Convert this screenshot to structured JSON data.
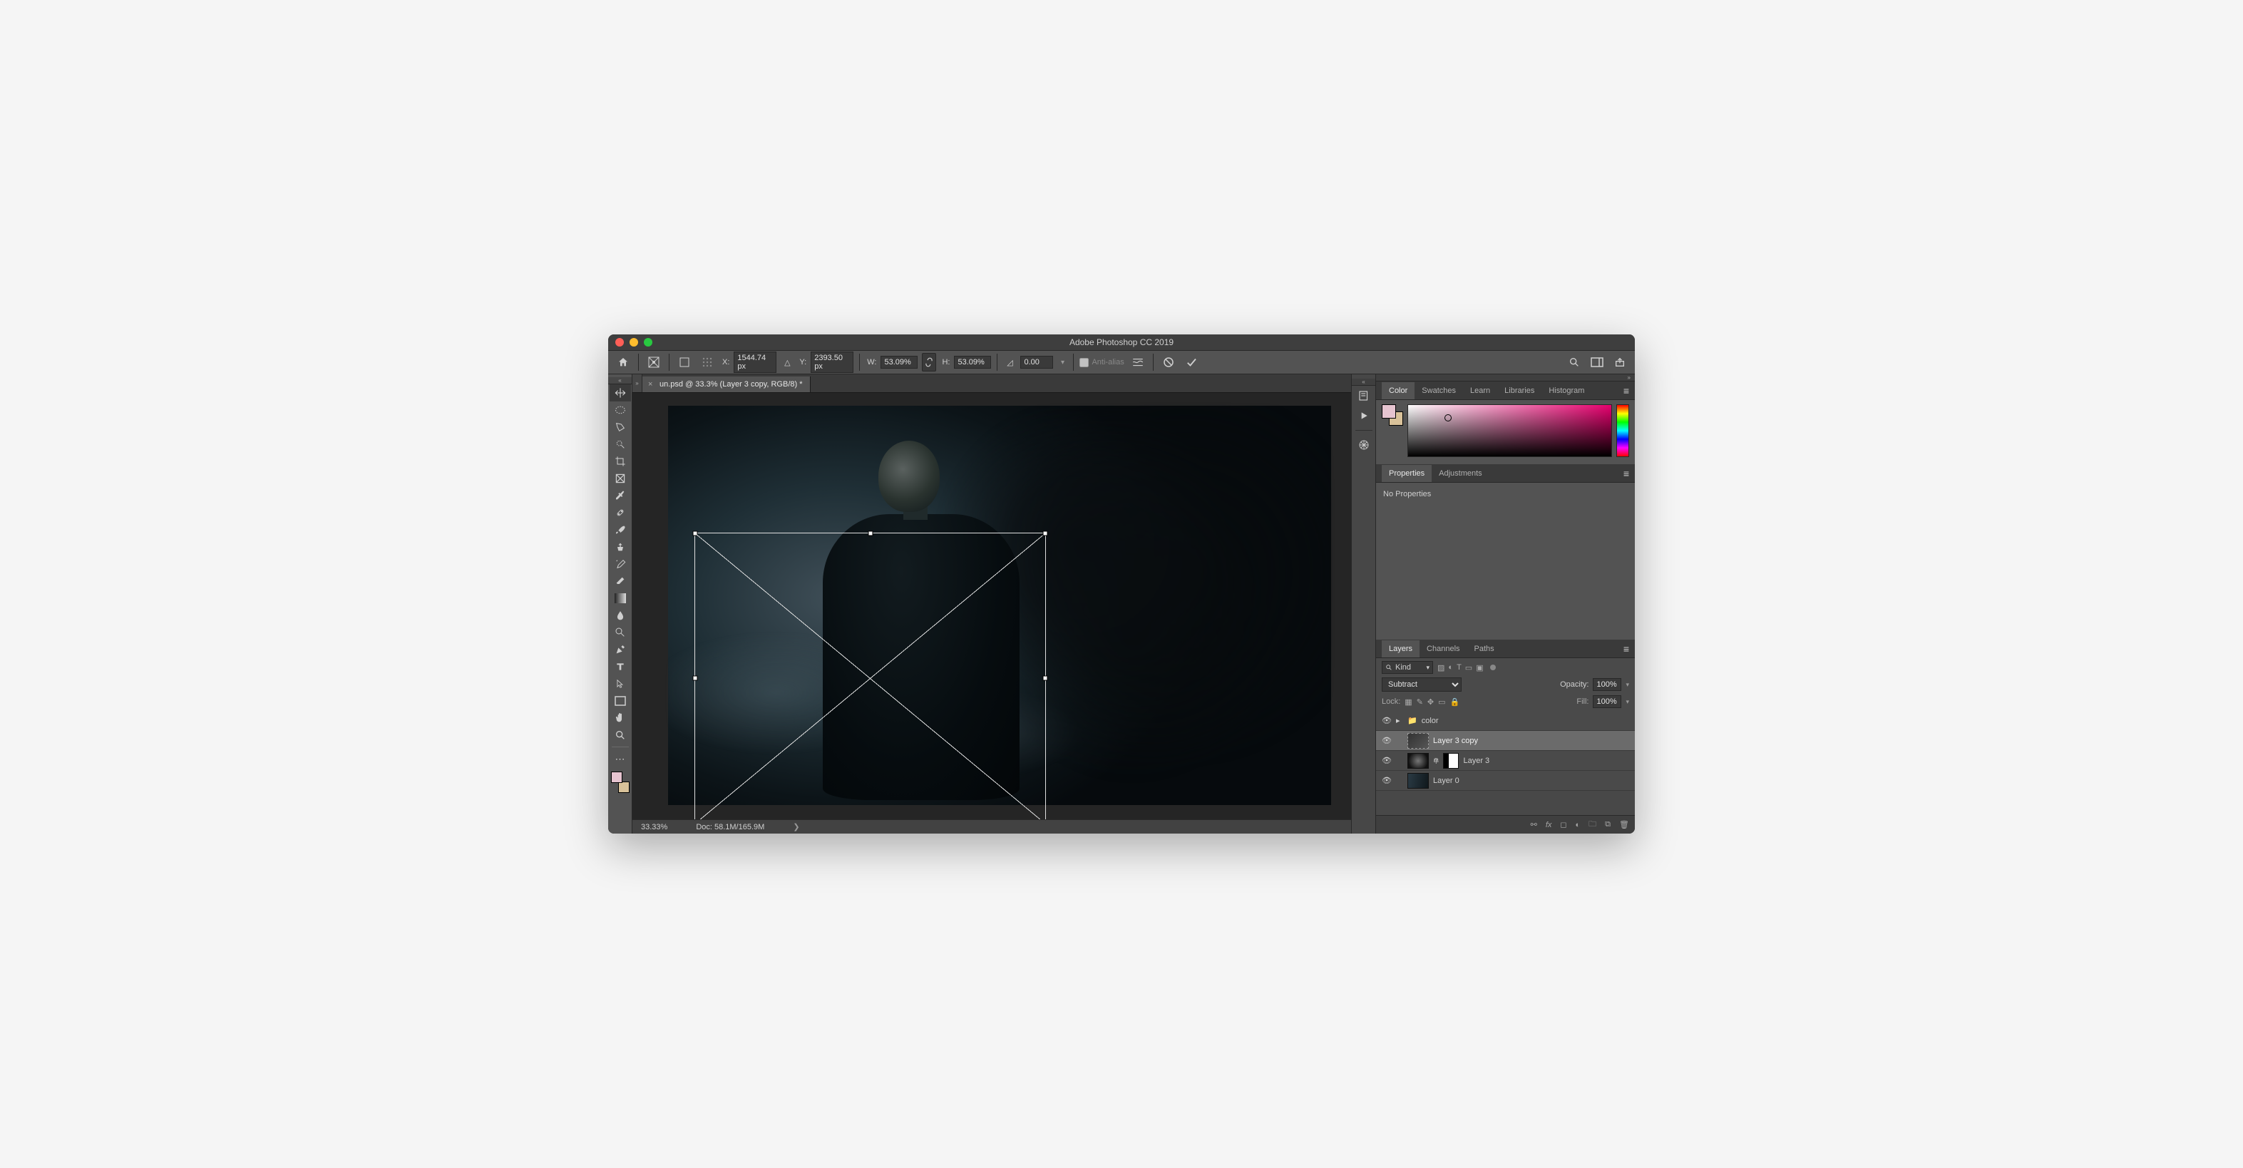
{
  "titlebar": {
    "title": "Adobe Photoshop CC 2019"
  },
  "options": {
    "x_label": "X:",
    "x_value": "1544.74 px",
    "y_label": "Y:",
    "y_value": "2393.50 px",
    "w_label": "W:",
    "w_value": "53.09%",
    "h_label": "H:",
    "h_value": "53.09%",
    "angle_value": "0.00",
    "antialias_label": "Anti-alias"
  },
  "tab": {
    "title": "un.psd @ 33.3% (Layer 3 copy, RGB/8) *"
  },
  "status": {
    "zoom": "33.33%",
    "doc": "Doc: 58.1M/165.9M"
  },
  "panels": {
    "color_tabs": [
      "Color",
      "Swatches",
      "Learn",
      "Libraries",
      "Histogram"
    ],
    "prop_tabs": [
      "Properties",
      "Adjustments"
    ],
    "prop_text": "No Properties",
    "layer_tabs": [
      "Layers",
      "Channels",
      "Paths"
    ],
    "kind_label": "Kind",
    "blend_mode": "Subtract",
    "opacity_label": "Opacity:",
    "opacity_value": "100%",
    "lock_label": "Lock:",
    "fill_label": "Fill:",
    "fill_value": "100%",
    "layers": [
      {
        "name": "color",
        "group": true
      },
      {
        "name": "Layer 3 copy",
        "selected": true
      },
      {
        "name": "Layer 3",
        "mask": true
      },
      {
        "name": "Layer 0"
      }
    ]
  }
}
